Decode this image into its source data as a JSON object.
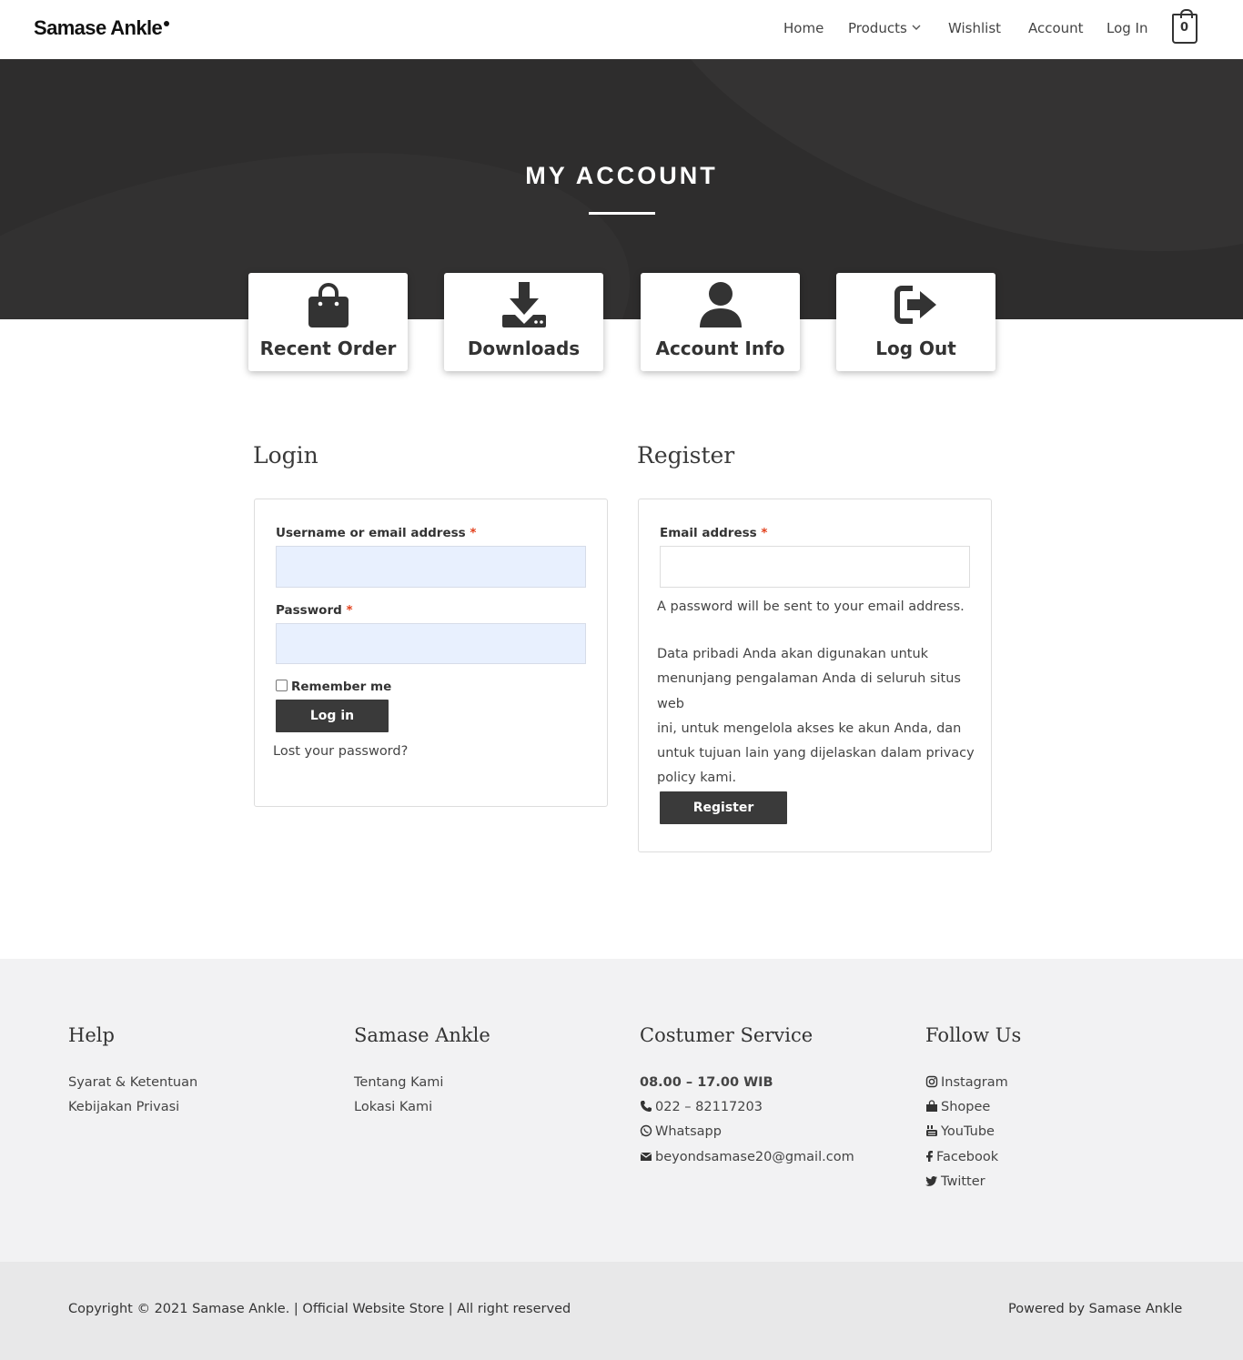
{
  "header": {
    "logo": "Samase Ankle",
    "nav": [
      "Home",
      "Products",
      "Wishlist",
      "Account",
      "Log In"
    ],
    "cart_count": "0"
  },
  "hero": {
    "title": "MY ACCOUNT"
  },
  "cards": [
    {
      "label": "Recent Order",
      "icon": "shopping-bag-icon"
    },
    {
      "label": "Downloads",
      "icon": "download-icon"
    },
    {
      "label": "Account Info",
      "icon": "user-icon"
    },
    {
      "label": "Log Out",
      "icon": "sign-out-icon"
    }
  ],
  "login": {
    "title": "Login",
    "username_label": "Username or email address",
    "password_label": "Password",
    "required_mark": "*",
    "remember_label": "Remember me",
    "submit_label": "Log in",
    "lost_password": "Lost your password?"
  },
  "register": {
    "title": "Register",
    "email_label": "Email address",
    "required_mark": "*",
    "password_note": "A password will be sent to your email address.",
    "privacy_lines": [
      "Data pribadi Anda akan digunakan untuk",
      "menunjang pengalaman Anda di seluruh situs web",
      "ini, untuk mengelola akses ke akun Anda, dan",
      "untuk tujuan lain yang dijelaskan dalam privacy",
      "policy kami."
    ],
    "submit_label": "Register"
  },
  "footer": {
    "help": {
      "title": "Help",
      "links": [
        "Syarat & Ketentuan",
        "Kebijakan Privasi"
      ]
    },
    "brand": {
      "title": "Samase Ankle",
      "links": [
        "Tentang Kami",
        "Lokasi Kami"
      ]
    },
    "service": {
      "title": "Costumer Service",
      "hours": "08.00 – 17.00 WIB",
      "phone": "022 – 82117203",
      "whatsapp": "Whatsapp",
      "email": "beyondsamase20@gmail.com"
    },
    "follow": {
      "title": "Follow Us",
      "links": [
        "Instagram",
        "Shopee",
        "YouTube",
        "Facebook",
        "Twitter"
      ]
    },
    "copyright": "Copyright © 2021 Samase Ankle. | Official Website Store | All right reserved",
    "powered": "Powered by Samase Ankle"
  },
  "colors": {
    "hero_bg": "#2e2d2d",
    "button_bg": "#3a3a3a",
    "required": "#e2401c",
    "autofill_bg": "#e8f0fe",
    "footer_bg": "#f2f2f3",
    "bottom_bar_bg": "#e8e8e9"
  }
}
